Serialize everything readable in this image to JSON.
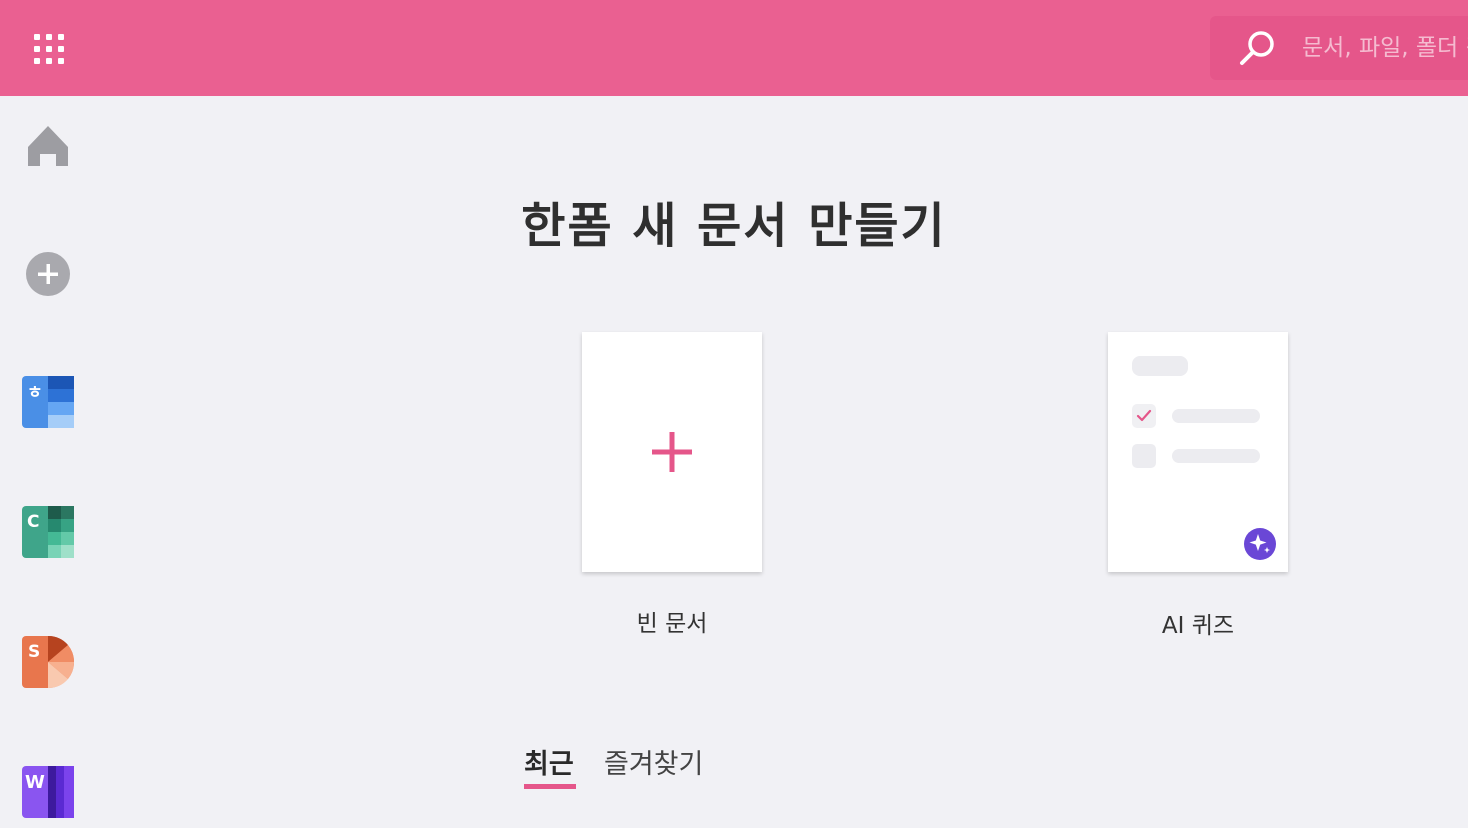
{
  "header": {
    "search_placeholder": "문서, 파일, 폴더 검색"
  },
  "main": {
    "title": "한폼 새 문서 만들기",
    "cards": [
      {
        "label": "빈 문서"
      },
      {
        "label": "AI 퀴즈"
      }
    ],
    "tabs": [
      {
        "label": "최근",
        "active": true
      },
      {
        "label": "즐겨찾기",
        "active": false
      }
    ]
  },
  "sidebar": {
    "apps": [
      {
        "letter": "ㅎ"
      },
      {
        "letter": "C"
      },
      {
        "letter": "S"
      },
      {
        "letter": "W"
      }
    ]
  },
  "colors": {
    "accent": "#ea6091",
    "ai_badge": "#6a47d6"
  }
}
